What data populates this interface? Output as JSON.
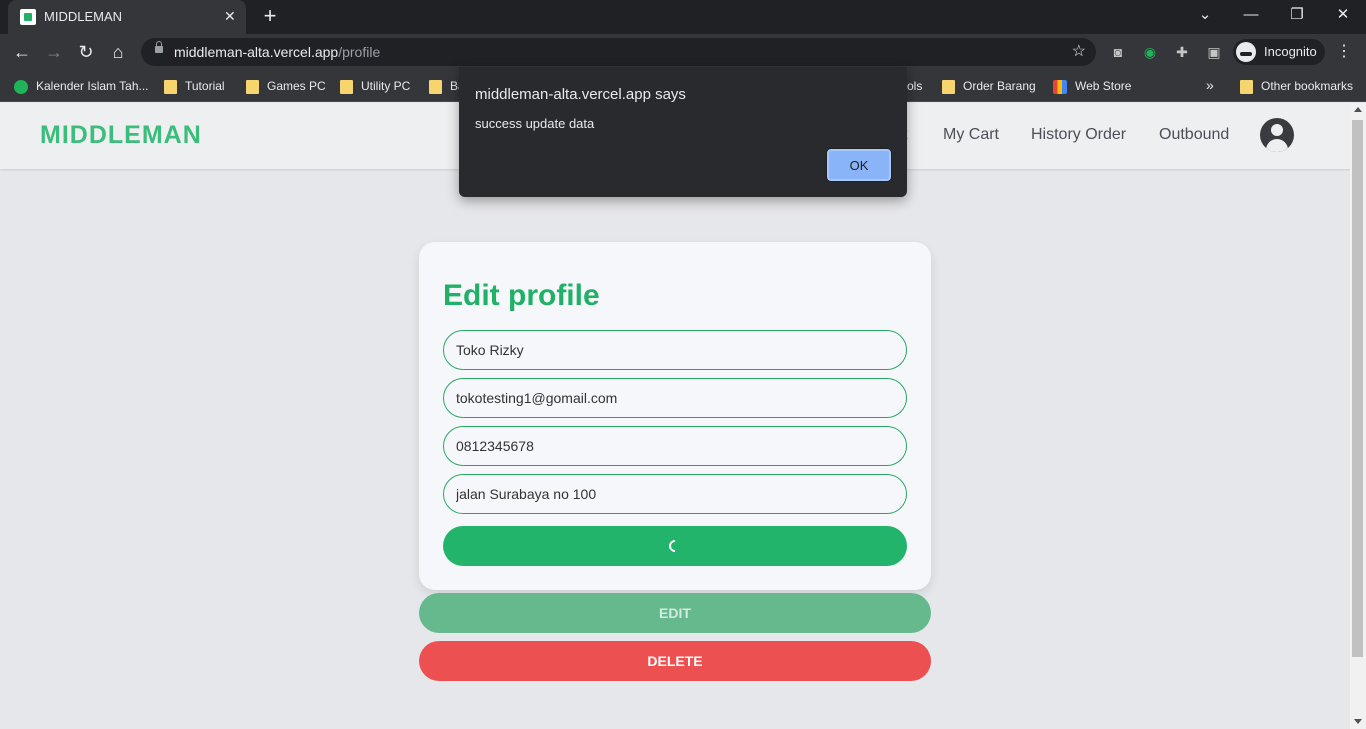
{
  "browser": {
    "tab_title": "MIDDLEMAN",
    "url_host": "middleman-alta.vercel.app",
    "url_path": "/profile",
    "incognito_label": "Incognito",
    "bookmarks": [
      {
        "label": "Kalender Islam Tah..."
      },
      {
        "label": "Tutorial"
      },
      {
        "label": "Games PC"
      },
      {
        "label": "Utility PC"
      },
      {
        "label": "Ba"
      },
      {
        "label": "ols"
      },
      {
        "label": "Order Barang"
      },
      {
        "label": "Web Store"
      }
    ],
    "other_bookmarks": "Other bookmarks"
  },
  "navbar": {
    "logo": "MIDDLEMAN",
    "links": [
      {
        "label": "t"
      },
      {
        "label": "My Cart"
      },
      {
        "label": "History Order"
      },
      {
        "label": "Outbound"
      }
    ]
  },
  "form": {
    "title": "Edit profile",
    "fields": {
      "name": "Toko Rizky",
      "email": "tokotesting1@gomail.com",
      "phone": "0812345678",
      "address": "jalan Surabaya no 100"
    }
  },
  "actions": {
    "edit": "EDIT",
    "delete": "DELETE"
  },
  "dialog": {
    "title": "middleman-alta.vercel.app says",
    "message": "success update data",
    "ok": "OK"
  },
  "colors": {
    "brand_green": "#21b067",
    "danger_red": "#ec5050"
  }
}
